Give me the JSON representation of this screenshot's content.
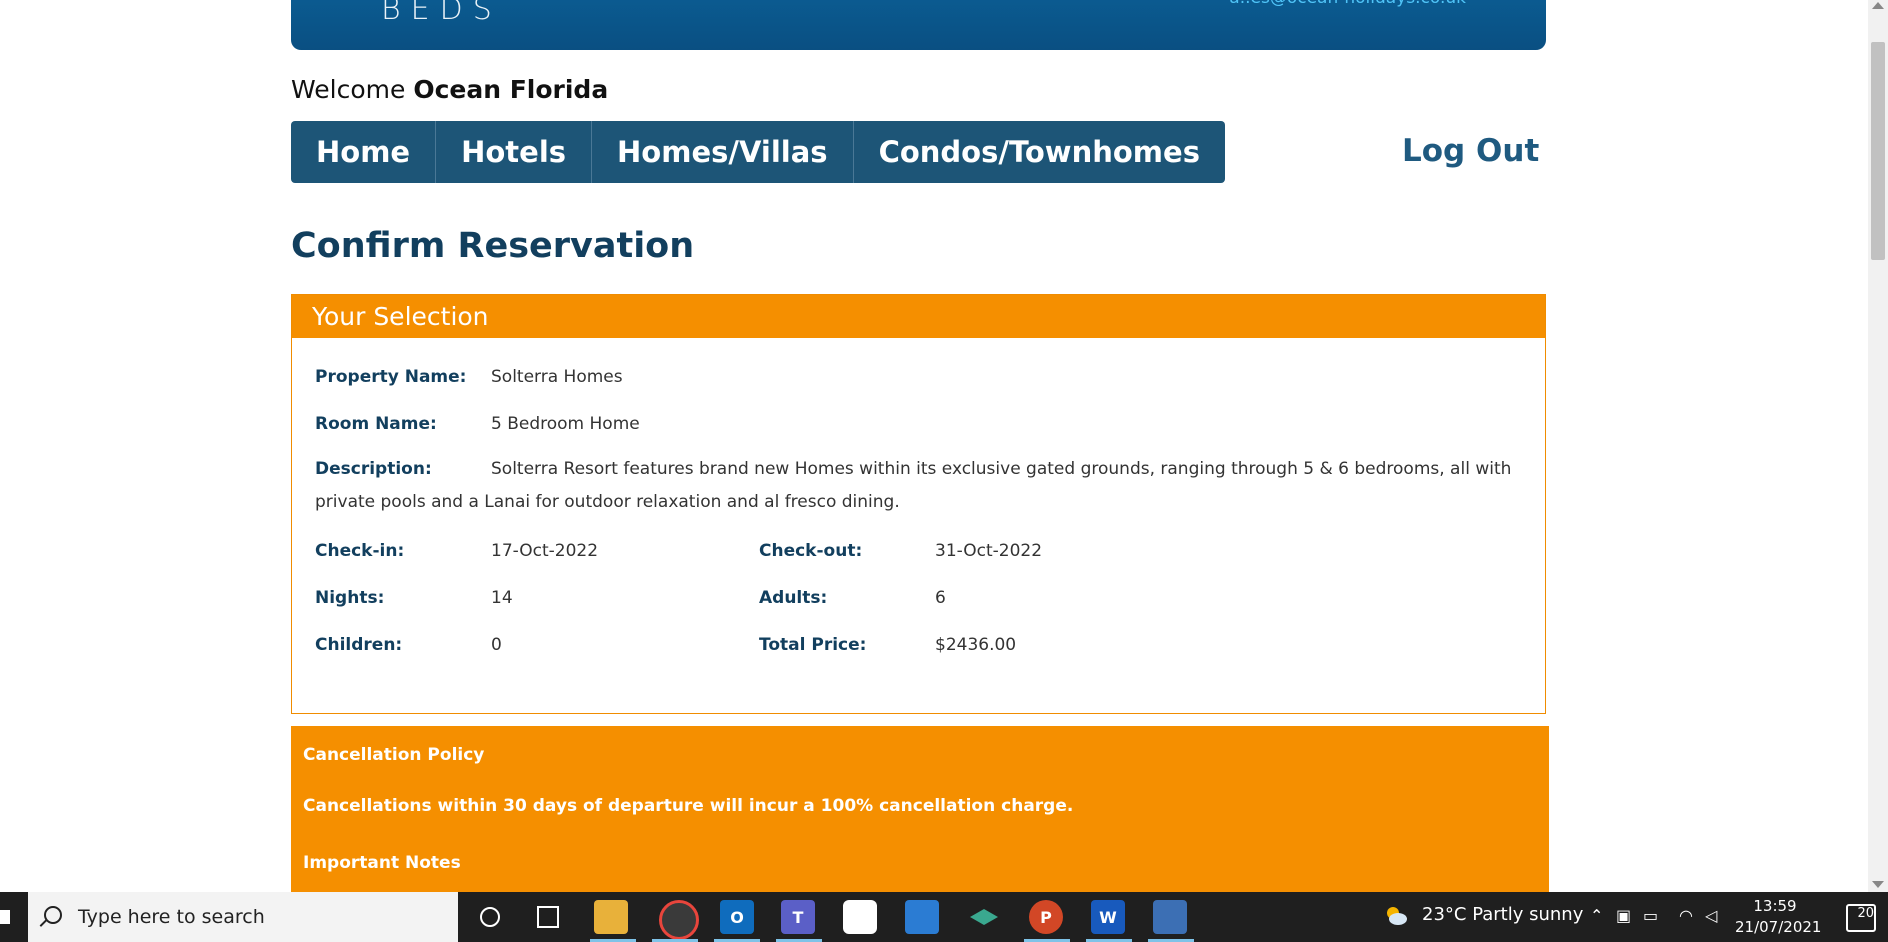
{
  "banner": {
    "logo_text": "BEDS",
    "email": "a..es@ocean-holidays.co.uk"
  },
  "welcome": {
    "prefix": "Welcome",
    "name": "Ocean Florida"
  },
  "nav": {
    "items": [
      "Home",
      "Hotels",
      "Homes/Villas",
      "Condos/Townhomes"
    ],
    "logout": "Log Out"
  },
  "page_title": "Confirm Reservation",
  "selection": {
    "header": "Your Selection",
    "property_label": "Property Name:",
    "property_value": "Solterra Homes",
    "room_label": "Room Name:",
    "room_value": "5 Bedroom Home",
    "desc_label": "Description:",
    "desc_value": "Solterra Resort features brand new Homes within its exclusive gated grounds, ranging through 5 & 6 bedrooms, all with private pools and a Lanai for outdoor relaxation and al fresco dining.",
    "checkin_label": "Check-in:",
    "checkin_value": "17-Oct-2022",
    "checkout_label": "Check-out:",
    "checkout_value": "31-Oct-2022",
    "nights_label": "Nights:",
    "nights_value": "14",
    "adults_label": "Adults:",
    "adults_value": "6",
    "children_label": "Children:",
    "children_value": "0",
    "total_label": "Total Price:",
    "total_value": "$2436.00"
  },
  "cancellation": {
    "title": "Cancellation Policy",
    "text": "Cancellations within 30 days of departure will incur a 100% cancellation charge.",
    "notes_title": "Important Notes"
  },
  "taskbar": {
    "search_placeholder": "Type here to search",
    "weather": "23°C  Partly sunny",
    "time": "13:59",
    "date": "21/07/2021",
    "notifications": "20"
  },
  "colors": {
    "brand": "#1d5577",
    "accent": "#f58f00",
    "title": "#123f5e"
  }
}
